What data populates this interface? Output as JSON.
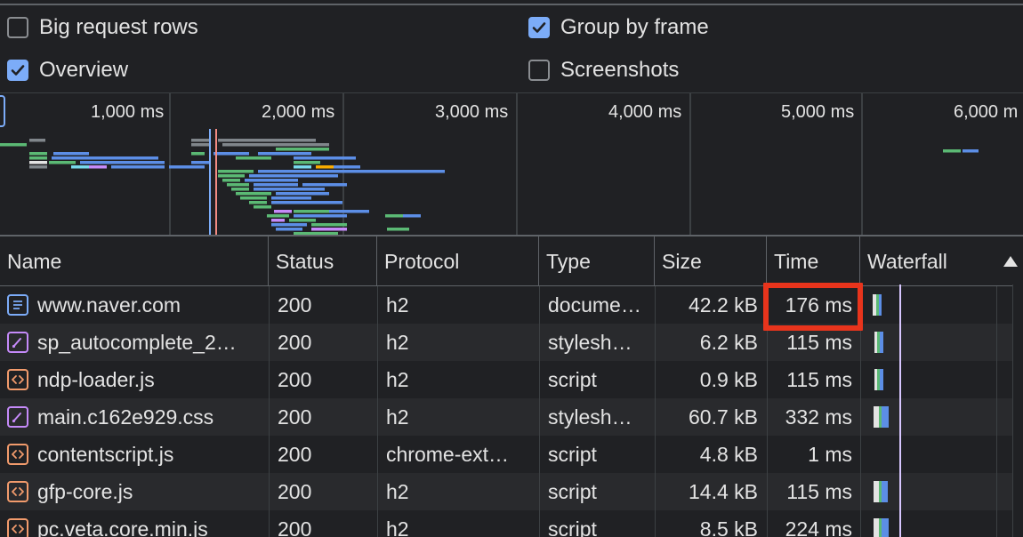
{
  "settings": {
    "big_request_rows": {
      "label": "Big request rows",
      "checked": false
    },
    "group_by_frame": {
      "label": "Group by frame",
      "checked": true
    },
    "overview": {
      "label": "Overview",
      "checked": true
    },
    "screenshots": {
      "label": "Screenshots",
      "checked": false
    }
  },
  "overview": {
    "ticks": [
      "1,000 ms",
      "2,000 ms",
      "3,000 ms",
      "4,000 ms",
      "5,000 ms",
      "6,000 m"
    ]
  },
  "table": {
    "columns": [
      "Name",
      "Status",
      "Protocol",
      "Type",
      "Size",
      "Time",
      "Waterfall"
    ],
    "rows": [
      {
        "icon": "document-icon",
        "name": "www.naver.com",
        "status": "200",
        "protocol": "h2",
        "type": "docume…",
        "size": "42.2 kB",
        "time": "176 ms"
      },
      {
        "icon": "stylesheet-icon",
        "name": "sp_autocomplete_2…",
        "status": "200",
        "protocol": "h2",
        "type": "stylesh…",
        "size": "6.2 kB",
        "time": "115 ms"
      },
      {
        "icon": "script-icon",
        "name": "ndp-loader.js",
        "status": "200",
        "protocol": "h2",
        "type": "script",
        "size": "0.9 kB",
        "time": "115 ms"
      },
      {
        "icon": "stylesheet-icon",
        "name": "main.c162e929.css",
        "status": "200",
        "protocol": "h2",
        "type": "stylesh…",
        "size": "60.7 kB",
        "time": "332 ms"
      },
      {
        "icon": "script-icon",
        "name": "contentscript.js",
        "status": "200",
        "protocol": "chrome-ext…",
        "type": "script",
        "size": "4.8 kB",
        "time": "1 ms"
      },
      {
        "icon": "script-icon",
        "name": "gfp-core.js",
        "status": "200",
        "protocol": "h2",
        "type": "script",
        "size": "14.4 kB",
        "time": "115 ms"
      },
      {
        "icon": "script-icon",
        "name": "pc.veta.core.min.js",
        "status": "200",
        "protocol": "h2",
        "type": "script",
        "size": "8.5 kB",
        "time": "224 ms"
      }
    ]
  },
  "colors": {
    "accent": "#7cacf8",
    "highlight": "#e8341c",
    "bar_green": "#5bb974",
    "bar_blue": "#5c8ee6",
    "bar_gray": "#80868b",
    "bar_purple": "#c58af9",
    "bar_cyan": "#78d9ec",
    "bar_orange": "#f9ab00"
  }
}
